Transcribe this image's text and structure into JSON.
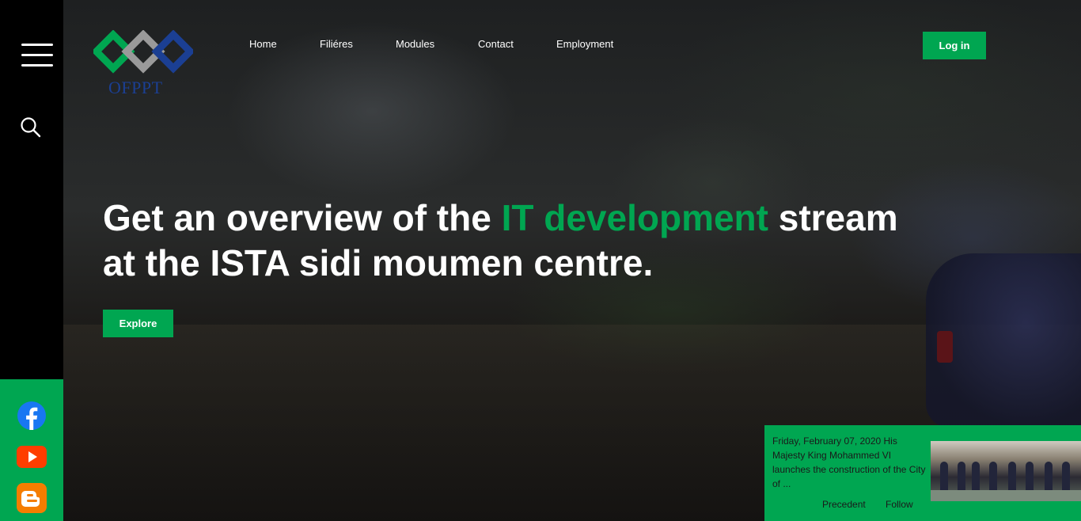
{
  "brand": {
    "logo_text": "OFPPT",
    "primary_color": "#00a651",
    "logo_blue": "#1b3f93",
    "logo_grey": "#9a9a9a"
  },
  "sidebar": {
    "menu_icon": "hamburger-menu-icon",
    "search_icon": "search-icon",
    "social": [
      {
        "name": "facebook",
        "icon": "facebook-icon"
      },
      {
        "name": "youtube",
        "icon": "youtube-icon"
      },
      {
        "name": "blogger",
        "icon": "blogger-icon"
      }
    ]
  },
  "nav": {
    "items": [
      {
        "label": "Home"
      },
      {
        "label": "Filiéres"
      },
      {
        "label": "Modules"
      },
      {
        "label": "Contact"
      },
      {
        "label": "Employment"
      }
    ],
    "login_label": "Log in"
  },
  "hero": {
    "title_part1": "Get an overview of the ",
    "title_accent": "IT development",
    "title_part2": " stream",
    "title_line2": "at the ISTA sidi moumen centre.",
    "cta_label": "Explore"
  },
  "news": {
    "text": "Friday, February 07, 2020 His Majesty King Mohammed VI launches the construction of the City of ...",
    "prev_label": "Precedent",
    "next_label": "Follow"
  }
}
